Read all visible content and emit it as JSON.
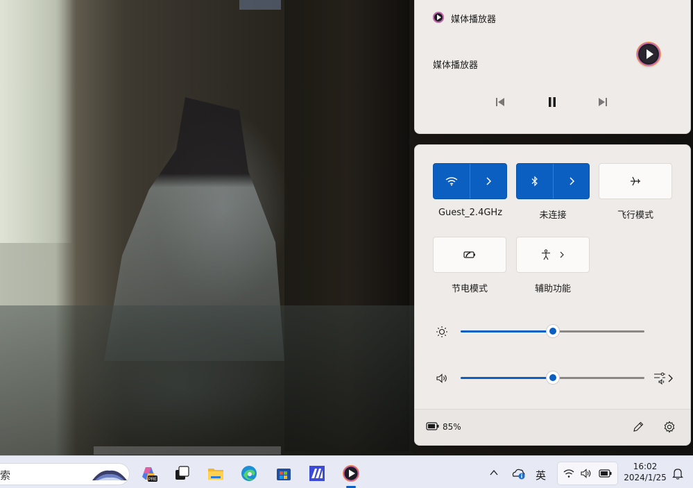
{
  "media_panel": {
    "app_name": "媒体播放器",
    "track_title": "媒体播放器",
    "previous_label": "previous-track-icon",
    "pause_label": "pause-icon",
    "next_label": "next-track-icon"
  },
  "quick_settings": {
    "tiles": [
      {
        "label": "Guest_2.4GHz",
        "icon": "wifi-icon",
        "state": "on"
      },
      {
        "label": "未连接",
        "icon": "bluetooth-icon",
        "state": "on"
      },
      {
        "label": "飞行模式",
        "icon": "airplane-icon",
        "state": "off"
      },
      {
        "label": "节电模式",
        "icon": "battery-saver-icon",
        "state": "off"
      },
      {
        "label": "辅助功能",
        "icon": "accessibility-icon",
        "state": "off"
      }
    ],
    "brightness_level": 0.5,
    "volume_level": 0.5,
    "battery_text": "85%"
  },
  "taskbar": {
    "search_text": "索",
    "ime_label": "英",
    "time": "16:02",
    "date": "2024/1/25"
  },
  "colors": {
    "accent": "#0a5fc1",
    "panel_bg": "#efebe8",
    "taskbar_bg": "#e7e9f4"
  }
}
